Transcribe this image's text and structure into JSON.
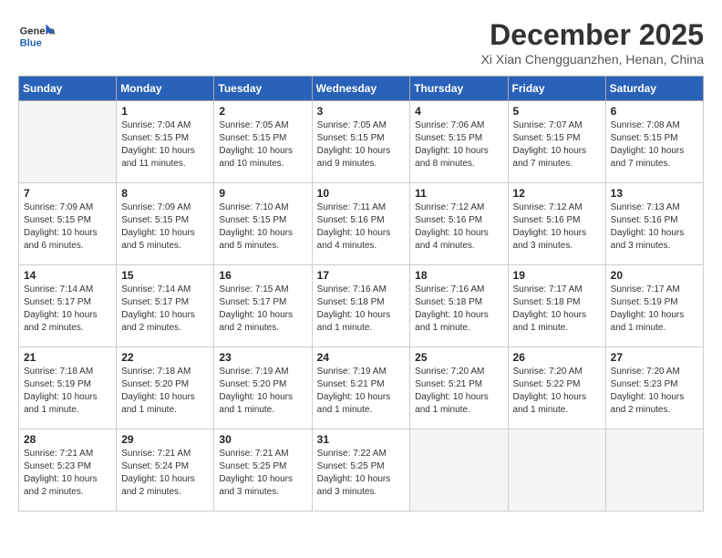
{
  "header": {
    "logo_line1": "General",
    "logo_line2": "Blue",
    "month_title": "December 2025",
    "location": "Xi Xian Chengguanzhen, Henan, China"
  },
  "days_of_week": [
    "Sunday",
    "Monday",
    "Tuesday",
    "Wednesday",
    "Thursday",
    "Friday",
    "Saturday"
  ],
  "weeks": [
    [
      {
        "day": "",
        "empty": true
      },
      {
        "day": "1",
        "sunrise": "7:04 AM",
        "sunset": "5:15 PM",
        "daylight": "10 hours and 11 minutes."
      },
      {
        "day": "2",
        "sunrise": "7:05 AM",
        "sunset": "5:15 PM",
        "daylight": "10 hours and 10 minutes."
      },
      {
        "day": "3",
        "sunrise": "7:05 AM",
        "sunset": "5:15 PM",
        "daylight": "10 hours and 9 minutes."
      },
      {
        "day": "4",
        "sunrise": "7:06 AM",
        "sunset": "5:15 PM",
        "daylight": "10 hours and 8 minutes."
      },
      {
        "day": "5",
        "sunrise": "7:07 AM",
        "sunset": "5:15 PM",
        "daylight": "10 hours and 7 minutes."
      },
      {
        "day": "6",
        "sunrise": "7:08 AM",
        "sunset": "5:15 PM",
        "daylight": "10 hours and 7 minutes."
      }
    ],
    [
      {
        "day": "7",
        "sunrise": "7:09 AM",
        "sunset": "5:15 PM",
        "daylight": "10 hours and 6 minutes."
      },
      {
        "day": "8",
        "sunrise": "7:09 AM",
        "sunset": "5:15 PM",
        "daylight": "10 hours and 5 minutes."
      },
      {
        "day": "9",
        "sunrise": "7:10 AM",
        "sunset": "5:15 PM",
        "daylight": "10 hours and 5 minutes."
      },
      {
        "day": "10",
        "sunrise": "7:11 AM",
        "sunset": "5:16 PM",
        "daylight": "10 hours and 4 minutes."
      },
      {
        "day": "11",
        "sunrise": "7:12 AM",
        "sunset": "5:16 PM",
        "daylight": "10 hours and 4 minutes."
      },
      {
        "day": "12",
        "sunrise": "7:12 AM",
        "sunset": "5:16 PM",
        "daylight": "10 hours and 3 minutes."
      },
      {
        "day": "13",
        "sunrise": "7:13 AM",
        "sunset": "5:16 PM",
        "daylight": "10 hours and 3 minutes."
      }
    ],
    [
      {
        "day": "14",
        "sunrise": "7:14 AM",
        "sunset": "5:17 PM",
        "daylight": "10 hours and 2 minutes."
      },
      {
        "day": "15",
        "sunrise": "7:14 AM",
        "sunset": "5:17 PM",
        "daylight": "10 hours and 2 minutes."
      },
      {
        "day": "16",
        "sunrise": "7:15 AM",
        "sunset": "5:17 PM",
        "daylight": "10 hours and 2 minutes."
      },
      {
        "day": "17",
        "sunrise": "7:16 AM",
        "sunset": "5:18 PM",
        "daylight": "10 hours and 1 minute."
      },
      {
        "day": "18",
        "sunrise": "7:16 AM",
        "sunset": "5:18 PM",
        "daylight": "10 hours and 1 minute."
      },
      {
        "day": "19",
        "sunrise": "7:17 AM",
        "sunset": "5:18 PM",
        "daylight": "10 hours and 1 minute."
      },
      {
        "day": "20",
        "sunrise": "7:17 AM",
        "sunset": "5:19 PM",
        "daylight": "10 hours and 1 minute."
      }
    ],
    [
      {
        "day": "21",
        "sunrise": "7:18 AM",
        "sunset": "5:19 PM",
        "daylight": "10 hours and 1 minute."
      },
      {
        "day": "22",
        "sunrise": "7:18 AM",
        "sunset": "5:20 PM",
        "daylight": "10 hours and 1 minute."
      },
      {
        "day": "23",
        "sunrise": "7:19 AM",
        "sunset": "5:20 PM",
        "daylight": "10 hours and 1 minute."
      },
      {
        "day": "24",
        "sunrise": "7:19 AM",
        "sunset": "5:21 PM",
        "daylight": "10 hours and 1 minute."
      },
      {
        "day": "25",
        "sunrise": "7:20 AM",
        "sunset": "5:21 PM",
        "daylight": "10 hours and 1 minute."
      },
      {
        "day": "26",
        "sunrise": "7:20 AM",
        "sunset": "5:22 PM",
        "daylight": "10 hours and 1 minute."
      },
      {
        "day": "27",
        "sunrise": "7:20 AM",
        "sunset": "5:23 PM",
        "daylight": "10 hours and 2 minutes."
      }
    ],
    [
      {
        "day": "28",
        "sunrise": "7:21 AM",
        "sunset": "5:23 PM",
        "daylight": "10 hours and 2 minutes."
      },
      {
        "day": "29",
        "sunrise": "7:21 AM",
        "sunset": "5:24 PM",
        "daylight": "10 hours and 2 minutes."
      },
      {
        "day": "30",
        "sunrise": "7:21 AM",
        "sunset": "5:25 PM",
        "daylight": "10 hours and 3 minutes."
      },
      {
        "day": "31",
        "sunrise": "7:22 AM",
        "sunset": "5:25 PM",
        "daylight": "10 hours and 3 minutes."
      },
      {
        "day": "",
        "empty": true
      },
      {
        "day": "",
        "empty": true
      },
      {
        "day": "",
        "empty": true
      }
    ]
  ]
}
